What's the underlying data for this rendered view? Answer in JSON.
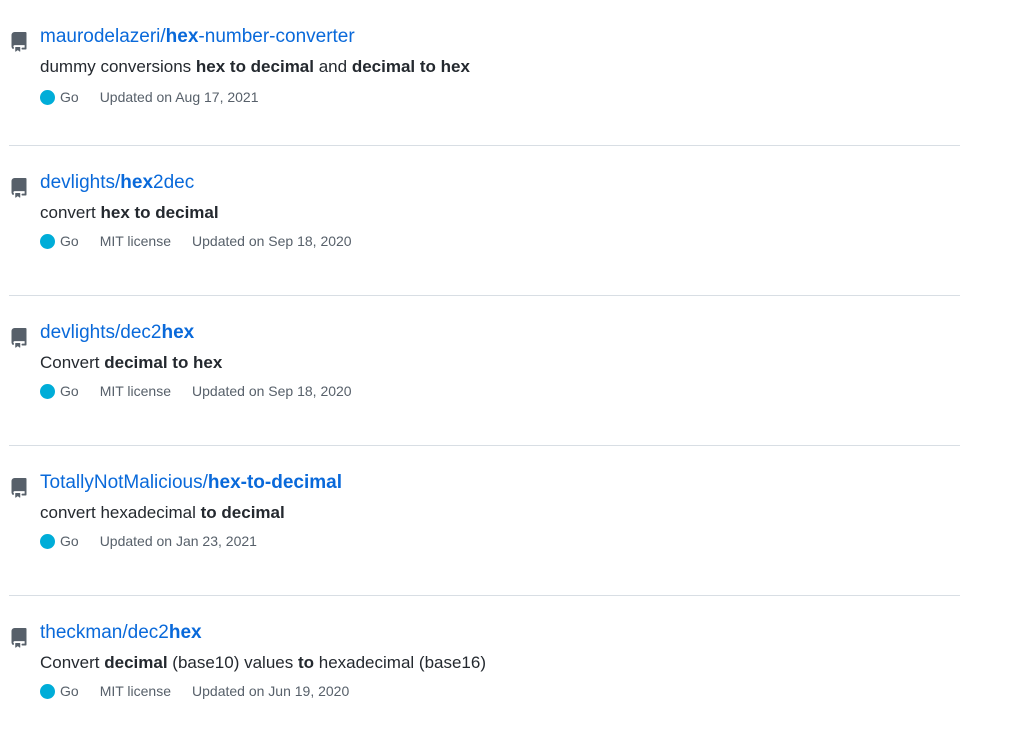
{
  "theme": {
    "link_color": "#0969da",
    "text_color": "#24292f",
    "muted_color": "#57606a",
    "go_language_color": "#00ADD8"
  },
  "repos": [
    {
      "icon": "repo-icon",
      "title_parts": [
        {
          "text": "maurodelazeri/",
          "hl": false
        },
        {
          "text": "hex",
          "hl": true
        },
        {
          "text": "-number-converter",
          "hl": false
        }
      ],
      "desc_parts": [
        {
          "text": "dummy conversions ",
          "hl": false
        },
        {
          "text": "hex to decimal",
          "hl": true
        },
        {
          "text": " and ",
          "hl": false
        },
        {
          "text": "decimal to hex",
          "hl": true
        }
      ],
      "language": "Go",
      "license": "",
      "updated": "Updated on Aug 17, 2021"
    },
    {
      "icon": "repo-icon",
      "title_parts": [
        {
          "text": "devlights/",
          "hl": false
        },
        {
          "text": "hex",
          "hl": true
        },
        {
          "text": "2dec",
          "hl": false
        }
      ],
      "desc_parts": [
        {
          "text": "convert ",
          "hl": false
        },
        {
          "text": "hex to decimal",
          "hl": true
        }
      ],
      "language": "Go",
      "license": "MIT license",
      "updated": "Updated on Sep 18, 2020"
    },
    {
      "icon": "repo-icon",
      "title_parts": [
        {
          "text": "devlights/dec2",
          "hl": false
        },
        {
          "text": "hex",
          "hl": true
        }
      ],
      "desc_parts": [
        {
          "text": "Convert ",
          "hl": false
        },
        {
          "text": "decimal to hex",
          "hl": true
        }
      ],
      "language": "Go",
      "license": "MIT license",
      "updated": "Updated on Sep 18, 2020"
    },
    {
      "icon": "repo-icon",
      "title_parts": [
        {
          "text": "TotallyNotMalicious/",
          "hl": false
        },
        {
          "text": "hex-to-decimal",
          "hl": true
        }
      ],
      "desc_parts": [
        {
          "text": "convert hexadecimal ",
          "hl": false
        },
        {
          "text": "to decimal",
          "hl": true
        }
      ],
      "language": "Go",
      "license": "",
      "updated": "Updated on Jan 23, 2021"
    },
    {
      "icon": "repo-icon",
      "title_parts": [
        {
          "text": "theckman/dec2",
          "hl": false
        },
        {
          "text": "hex",
          "hl": true
        }
      ],
      "desc_parts": [
        {
          "text": "Convert ",
          "hl": false
        },
        {
          "text": "decimal",
          "hl": true
        },
        {
          "text": " (base10) values ",
          "hl": false
        },
        {
          "text": "to",
          "hl": true
        },
        {
          "text": " hexadecimal (base16)",
          "hl": false
        }
      ],
      "language": "Go",
      "license": "MIT license",
      "updated": "Updated on Jun 19, 2020"
    }
  ]
}
